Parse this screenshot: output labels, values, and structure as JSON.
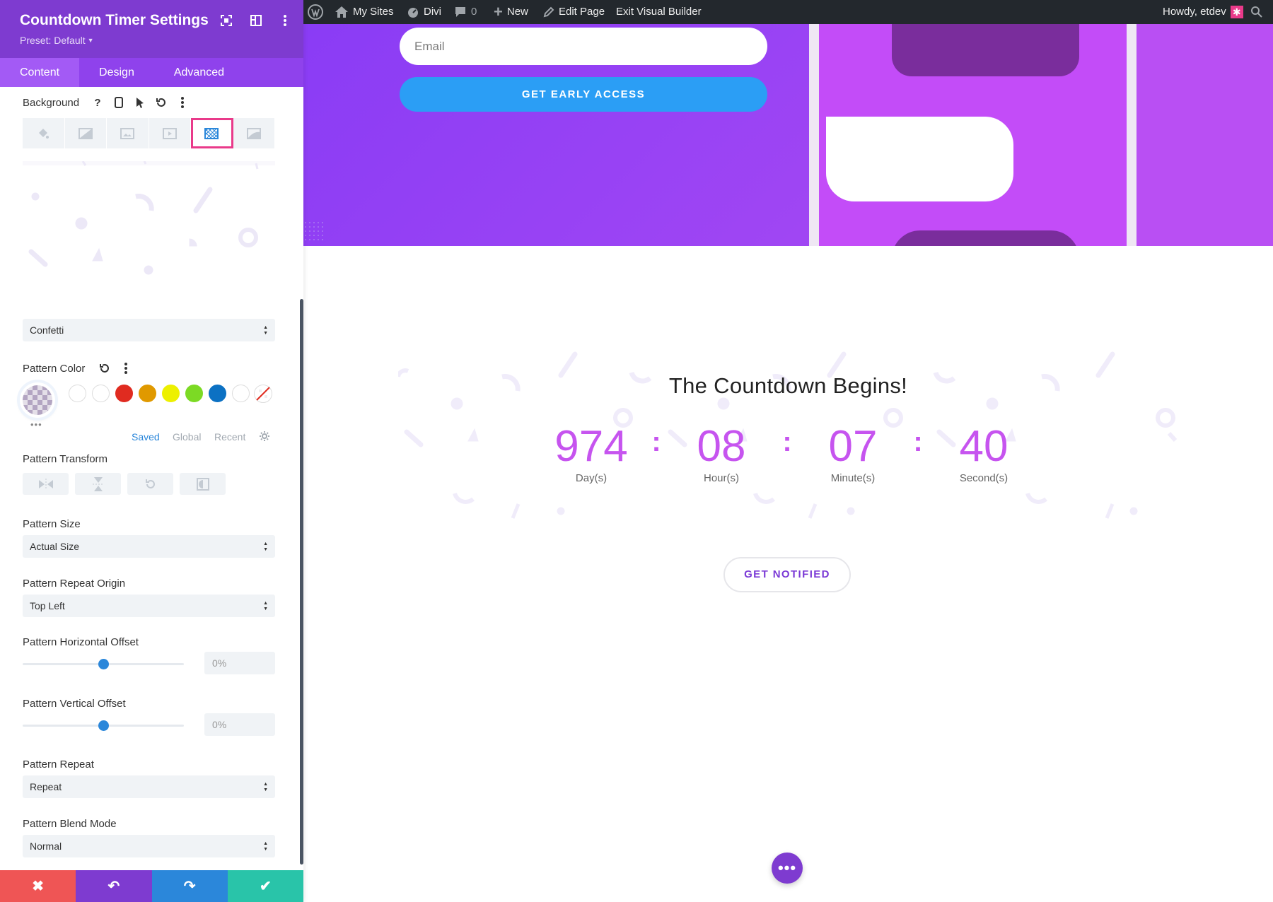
{
  "panel": {
    "title": "Countdown Timer Settings",
    "preset": "Preset: Default",
    "tabs": [
      {
        "label": "Content",
        "active": true
      },
      {
        "label": "Design",
        "active": false
      },
      {
        "label": "Advanced",
        "active": false
      }
    ],
    "background_label": "Background",
    "background_tabs": [
      "color-icon",
      "gradient-icon",
      "image-icon",
      "video-icon",
      "pattern-icon",
      "mask-icon"
    ],
    "active_background_tab": "pattern-icon",
    "pattern_select": "Confetti",
    "pattern_color": {
      "label": "Pattern Color",
      "swatches": [
        "#ffffff",
        "#ffffff",
        "#e02b20",
        "#e09900",
        "#edf000",
        "#7cda24",
        "#0c71c3",
        "#ffffff"
      ],
      "tabs": [
        "Saved",
        "Global",
        "Recent"
      ],
      "active_tab": "Saved",
      "more": "•••"
    },
    "pattern_transform_label": "Pattern Transform",
    "pattern_size": {
      "label": "Pattern Size",
      "value": "Actual Size"
    },
    "pattern_repeat_origin": {
      "label": "Pattern Repeat Origin",
      "value": "Top Left"
    },
    "pattern_h_offset": {
      "label": "Pattern Horizontal Offset",
      "value": "0%",
      "fraction": 0.5
    },
    "pattern_v_offset": {
      "label": "Pattern Vertical Offset",
      "value": "0%",
      "fraction": 0.5
    },
    "pattern_repeat": {
      "label": "Pattern Repeat",
      "value": "Repeat"
    },
    "pattern_blend": {
      "label": "Pattern Blend Mode",
      "value": "Normal"
    },
    "footer": {
      "cancel": "✖",
      "undo": "↶",
      "redo": "↷",
      "save": "✔",
      "colors": [
        "#ef5555",
        "#7e3bd0",
        "#2b87da",
        "#29c4a9"
      ]
    }
  },
  "adminbar": {
    "my_sites": "My Sites",
    "divi": "Divi",
    "comments": "0",
    "new": "New",
    "edit_page": "Edit Page",
    "exit": "Exit Visual Builder",
    "howdy": "Howdy, etdev"
  },
  "hero": {
    "email_placeholder": "Email",
    "cta": "GET EARLY ACCESS"
  },
  "countdown": {
    "title": "The Countdown Begins!",
    "units": [
      {
        "value": "974",
        "label": "Day(s)"
      },
      {
        "value": "08",
        "label": "Hour(s)"
      },
      {
        "value": "07",
        "label": "Minute(s)"
      },
      {
        "value": "40",
        "label": "Second(s)"
      }
    ],
    "separator": ":",
    "notify": "GET NOTIFIED",
    "fab": "•••"
  },
  "colors": {
    "accent_purple": "#7e3bd0",
    "countdown_pink": "#c654ef",
    "blue": "#2b87da",
    "highlight": "#e93a8a"
  }
}
